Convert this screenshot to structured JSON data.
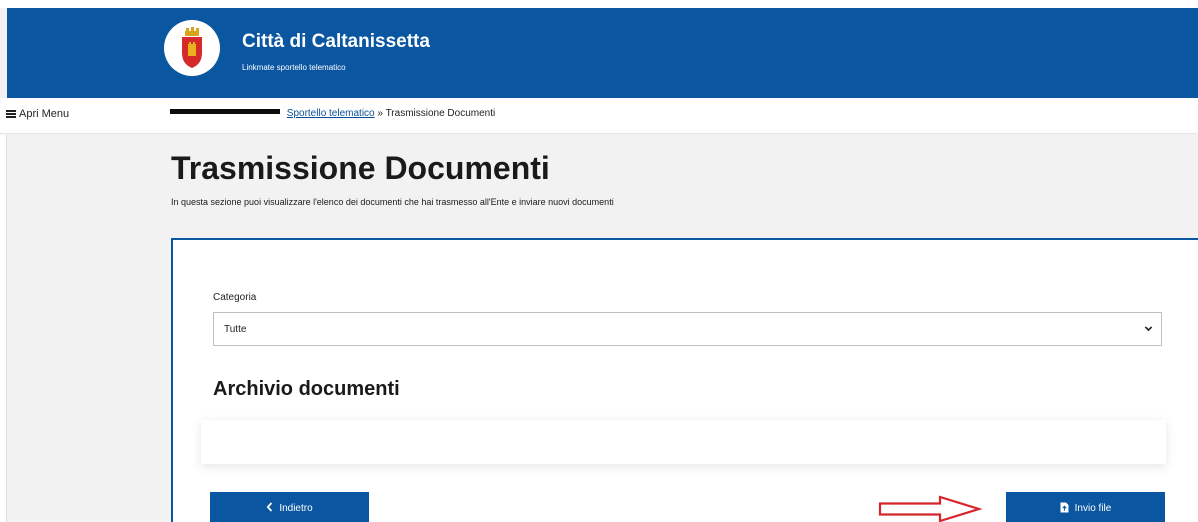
{
  "header": {
    "title": "Città di Caltanissetta",
    "subtitle": "Linkmate sportello telematico",
    "logo_icon": "city-crest"
  },
  "nav": {
    "menu_label": "Apri Menu",
    "menu_icon": "hamburger-icon"
  },
  "breadcrumb": {
    "link": "Sportello telematico",
    "separator": "»",
    "current": "Trasmissione Documenti"
  },
  "page": {
    "title": "Trasmissione Documenti",
    "description": "In questa sezione puoi visualizzare l'elenco dei documenti che hai trasmesso all'Ente e inviare nuovi documenti"
  },
  "form": {
    "category_label": "Categoria",
    "category_value": "Tutte"
  },
  "archive": {
    "title": "Archivio documenti",
    "items": []
  },
  "actions": {
    "back_label": "Indietro",
    "send_label": "Invio file"
  },
  "colors": {
    "primary": "#0a56a0",
    "annotation_arrow": "#d7262b"
  }
}
